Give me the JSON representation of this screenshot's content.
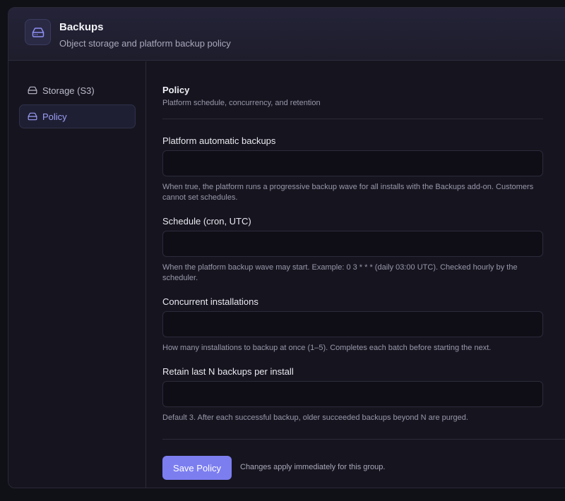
{
  "header": {
    "title": "Backups",
    "subtitle": "Object storage and platform backup policy",
    "icon": "hard-drive-icon"
  },
  "sidebar": {
    "items": [
      {
        "label": "Storage (S3)",
        "icon": "hard-drive-icon",
        "active": false
      },
      {
        "label": "Policy",
        "icon": "hard-drive-icon",
        "active": true
      }
    ]
  },
  "policy": {
    "title": "Policy",
    "subtitle": "Platform schedule, concurrency, and retention",
    "fields": [
      {
        "label": "Platform automatic backups",
        "value": "",
        "help": "When true, the platform runs a progressive backup wave for all installs with the Backups add-on. Customers cannot set schedules."
      },
      {
        "label": "Schedule (cron, UTC)",
        "value": "",
        "help": "When the platform backup wave may start. Example: 0 3 * * * (daily 03:00 UTC). Checked hourly by the scheduler."
      },
      {
        "label": "Concurrent installations",
        "value": "",
        "help": "How many installations to backup at once (1–5). Completes each batch before starting the next."
      },
      {
        "label": "Retain last N backups per install",
        "value": "",
        "help": "Default 3. After each successful backup, older succeeded backups beyond N are purged."
      }
    ],
    "save_label": "Save Policy",
    "save_note": "Changes apply immediately for this group."
  },
  "colors": {
    "accent": "#7c7ef0",
    "active_nav_text": "#9c9ff7",
    "background": "#101017",
    "panel": "#16151f"
  }
}
